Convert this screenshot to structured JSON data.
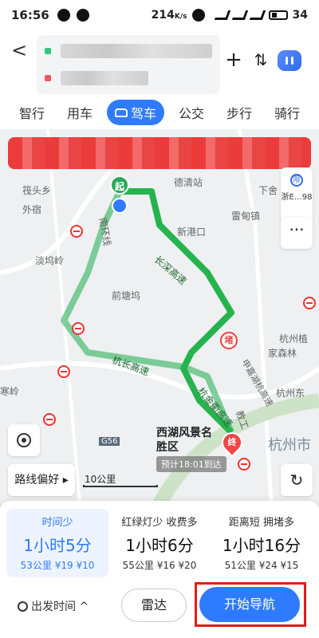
{
  "status_bar": {
    "time": "16:56",
    "speed": "214",
    "speed_unit": "K/s",
    "battery": "34"
  },
  "header": {
    "back": "<",
    "start_placeholder": "███████████████ ",
    "end_placeholder": "████████████",
    "plus": "+",
    "swap": "⇅"
  },
  "tabs": [
    "智行",
    "用车",
    "驾车",
    "公交",
    "步行",
    "骑行"
  ],
  "active_tab": "驾车",
  "map": {
    "pois": [
      "筏头乡",
      "外宿",
      "淡坞岭",
      "德清站",
      "雷甸镇",
      "下舍",
      "新港口",
      "前塘坞",
      "寒岭",
      "西湖风景名胜区",
      "杭州市",
      "杭州植",
      "家森林",
      "杭州东"
    ],
    "roads": [
      "长深高速",
      "杭长高速",
      "南环线",
      "申嘉湖杭高速",
      "杭金衢高速",
      "教工"
    ],
    "road_labels": [
      "G56"
    ],
    "start_label": "起",
    "end_label": "终",
    "jam_label": "堵",
    "side_text": "浙E…98",
    "side_badge": "限",
    "more": "···",
    "route_preference": "路线偏好 ▸",
    "scale": "10公里",
    "eta": "预计18:01到达",
    "refresh": "↻"
  },
  "plans": [
    {
      "tag": "时间少",
      "duration": "1小时5分",
      "info": "53公里 ¥19 ¥10",
      "selected": true
    },
    {
      "tag": "红绿灯少  收费多",
      "duration": "1小时6分",
      "info": "55公里 ¥16 ¥20",
      "selected": false
    },
    {
      "tag": "距离短  拥堵多",
      "duration": "1小时16分",
      "info": "51公里 ¥24 ¥15",
      "selected": false
    }
  ],
  "bottom": {
    "depart": "出发时间 ^",
    "radar": "雷达",
    "start_nav": "开始导航"
  },
  "colors": {
    "accent": "#2f7bff",
    "route": "#26b34e",
    "highlight_frame": "#e21b1b"
  }
}
